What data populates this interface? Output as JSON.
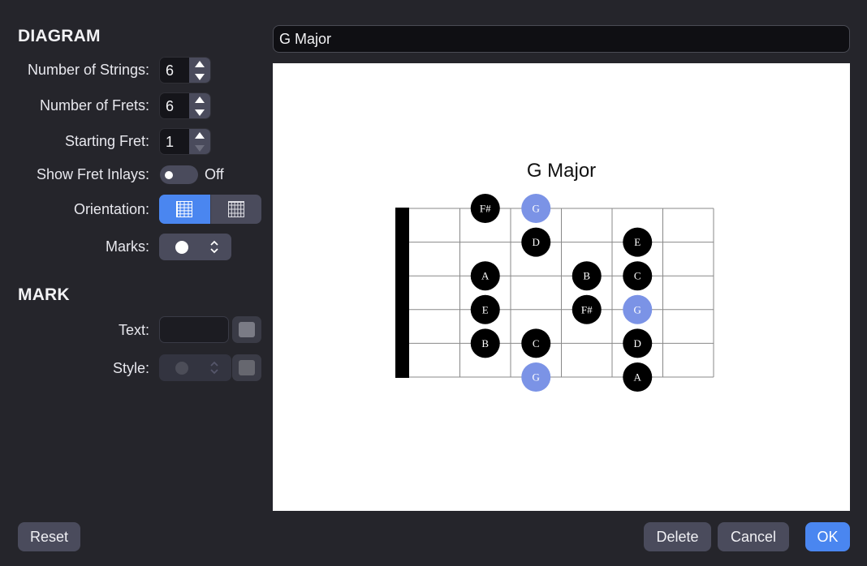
{
  "diagram": {
    "heading": "DIAGRAM",
    "strings": {
      "label": "Number of Strings:",
      "value": "6"
    },
    "frets": {
      "label": "Number of Frets:",
      "value": "6"
    },
    "starting_fret": {
      "label": "Starting Fret:",
      "value": "1"
    },
    "fret_inlays": {
      "label": "Show Fret Inlays:",
      "state": "Off"
    },
    "orientation": {
      "label": "Orientation:",
      "options": [
        "horizontal",
        "vertical"
      ],
      "selected": "horizontal"
    },
    "marks": {
      "label": "Marks:",
      "selected_icon": "filled-circle-icon"
    }
  },
  "mark": {
    "heading": "MARK",
    "text": {
      "label": "Text:",
      "value": ""
    },
    "style": {
      "label": "Style:"
    }
  },
  "title_input": {
    "value": "G Major"
  },
  "chart_title": "G Major",
  "fretboard": {
    "num_strings": 6,
    "num_frets": 6,
    "nut_visible": true,
    "colors": {
      "root": "#7b93e6",
      "note": "#000000",
      "lines": "#888888",
      "nut": "#000000"
    },
    "notes": [
      {
        "string": 1,
        "fret": 2,
        "label": "F#",
        "root": false
      },
      {
        "string": 1,
        "fret": 3,
        "label": "G",
        "root": true
      },
      {
        "string": 2,
        "fret": 3,
        "label": "D",
        "root": false
      },
      {
        "string": 2,
        "fret": 5,
        "label": "E",
        "root": false
      },
      {
        "string": 3,
        "fret": 2,
        "label": "A",
        "root": false
      },
      {
        "string": 3,
        "fret": 4,
        "label": "B",
        "root": false
      },
      {
        "string": 3,
        "fret": 5,
        "label": "C",
        "root": false
      },
      {
        "string": 4,
        "fret": 2,
        "label": "E",
        "root": false
      },
      {
        "string": 4,
        "fret": 4,
        "label": "F#",
        "root": false
      },
      {
        "string": 4,
        "fret": 5,
        "label": "G",
        "root": true
      },
      {
        "string": 5,
        "fret": 2,
        "label": "B",
        "root": false
      },
      {
        "string": 5,
        "fret": 3,
        "label": "C",
        "root": false
      },
      {
        "string": 5,
        "fret": 5,
        "label": "D",
        "root": false
      },
      {
        "string": 6,
        "fret": 3,
        "label": "G",
        "root": true
      },
      {
        "string": 6,
        "fret": 5,
        "label": "A",
        "root": false
      }
    ]
  },
  "buttons": {
    "reset": "Reset",
    "delete": "Delete",
    "cancel": "Cancel",
    "ok": "OK"
  }
}
